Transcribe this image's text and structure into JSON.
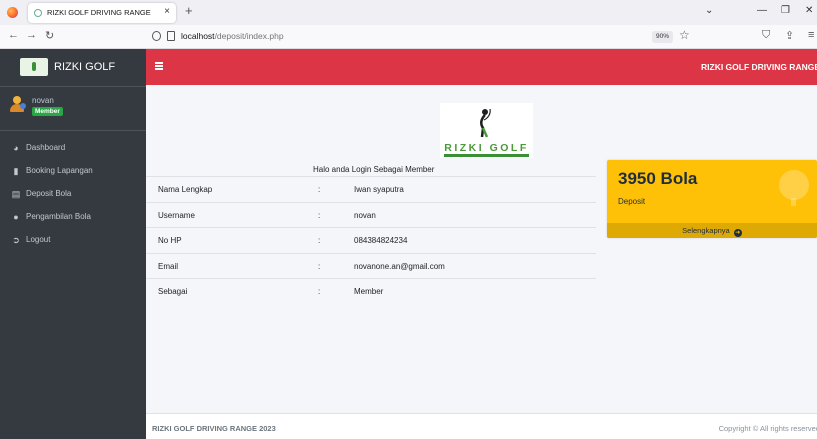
{
  "browser": {
    "tab_title": "RIZKI GOLF DRIVING RANGE",
    "tab_close": "×",
    "new_tab": "+",
    "url_host": "localhost",
    "url_path": "/deposit/index.php",
    "zoom": "90%",
    "win_minimize": "—",
    "win_maximize": "❐",
    "win_close": "✕",
    "win_dropdown": "⌄"
  },
  "sidebar": {
    "brand": "RIZKI GOLF",
    "user_name": "novan",
    "user_role": "Member",
    "items": [
      {
        "label": "Dashboard",
        "icon": "dashboard-icon"
      },
      {
        "label": "Booking Lapangan",
        "icon": "bookmark-icon"
      },
      {
        "label": "Deposit Bola",
        "icon": "table-icon"
      },
      {
        "label": "Pengambilan Bola",
        "icon": "lightbulb-icon"
      },
      {
        "label": "Logout",
        "icon": "arrow-circle-icon"
      }
    ]
  },
  "header": {
    "title": "RIZKI GOLF DRIVING RANGE"
  },
  "main": {
    "logo_text": "RIZKI GOLF",
    "login_info": "Halo anda Login Sebagai Member",
    "separator": ":",
    "rows": [
      {
        "key": "Nama Lengkap",
        "value": "Iwan syaputra"
      },
      {
        "key": "Username",
        "value": "novan"
      },
      {
        "key": "No HP",
        "value": "084384824234"
      },
      {
        "key": "Email",
        "value": "novanone.an@gmail.com"
      },
      {
        "key": "Sebagai",
        "value": "Member"
      }
    ]
  },
  "stat_box": {
    "number": "3950 Bola",
    "label": "Deposit",
    "link": "Selengkapnya",
    "color": "#ffc107"
  },
  "footer": {
    "left": "RIZKI GOLF DRIVING RANGE 2023",
    "right": "Copyright © All rights reserved"
  },
  "colors": {
    "header": "#dc3545",
    "sidebar": "#343a40",
    "badge": "#28a745"
  }
}
